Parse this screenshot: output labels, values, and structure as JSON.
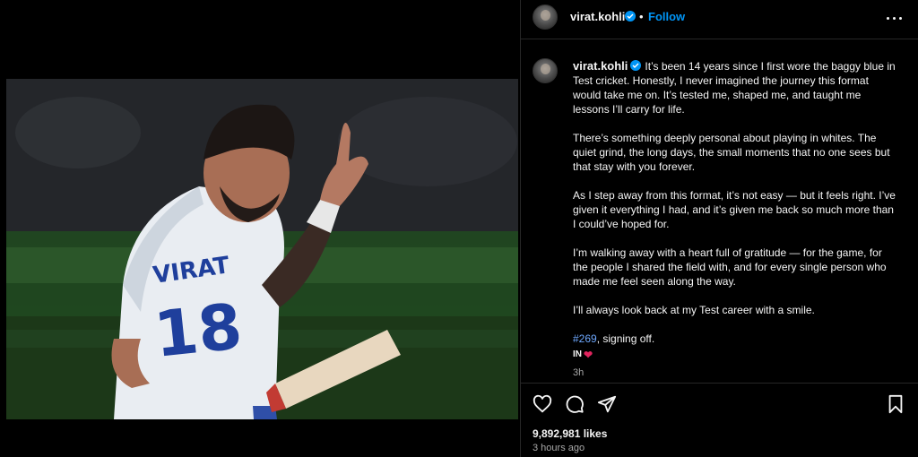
{
  "post": {
    "username": "virat.kohli",
    "follow_label": "Follow",
    "separator": "•",
    "caption_paragraphs": [
      "It’s been 14 years since I first wore the baggy blue in Test cricket. Honestly, I never imagined the journey this format would take me on. It’s tested me, shaped me, and taught me lessons I’ll carry for life.",
      "There’s something deeply personal about playing in whites. The quiet grind, the long days, the small moments that no one sees but that stay with you forever.",
      "As I step away from this format, it’s not easy — but it feels right. I’ve given it everything I had, and it’s given me back so much more than I could’ve hoped for.",
      "I’m walking away with a heart full of gratitude — for the game, for the people I shared the field with, and for every single person who made me feel seen along the way.",
      "I’ll always look back at my Test career with a smile."
    ],
    "hashtag": "#269",
    "hashtag_suffix": ", signing off.",
    "flag_text": "IN",
    "heart_emoji": "❤",
    "caption_time": "3h",
    "likes": "9,892,981 likes",
    "posted_ago": "3 hours ago",
    "photo": {
      "jersey_name": "VIRAT",
      "jersey_number": "18"
    }
  },
  "icons": {
    "verified": "verified-badge-icon",
    "more": "more-options-icon",
    "like": "heart-icon",
    "comment": "comment-icon",
    "share": "share-icon",
    "save": "bookmark-icon"
  },
  "colors": {
    "background": "#000000",
    "accent": "#0095f6",
    "hashtag": "#6ea8fe",
    "muted_text": "#a8a8a8",
    "divider": "#262626"
  }
}
